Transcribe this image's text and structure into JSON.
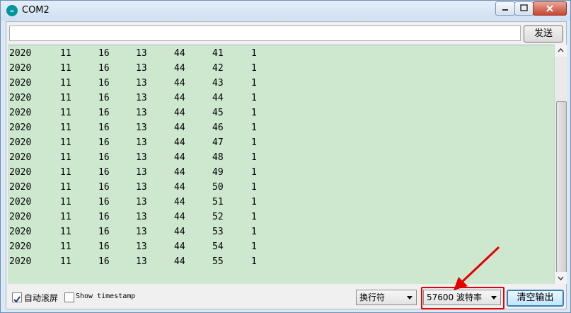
{
  "window": {
    "title": "COM2"
  },
  "send": {
    "input_value": "",
    "button_label": "发送"
  },
  "output": {
    "rows": [
      [
        "2020",
        "11",
        "16",
        "13",
        "44",
        "41",
        "1"
      ],
      [
        "2020",
        "11",
        "16",
        "13",
        "44",
        "42",
        "1"
      ],
      [
        "2020",
        "11",
        "16",
        "13",
        "44",
        "43",
        "1"
      ],
      [
        "2020",
        "11",
        "16",
        "13",
        "44",
        "44",
        "1"
      ],
      [
        "2020",
        "11",
        "16",
        "13",
        "44",
        "45",
        "1"
      ],
      [
        "2020",
        "11",
        "16",
        "13",
        "44",
        "46",
        "1"
      ],
      [
        "2020",
        "11",
        "16",
        "13",
        "44",
        "47",
        "1"
      ],
      [
        "2020",
        "11",
        "16",
        "13",
        "44",
        "48",
        "1"
      ],
      [
        "2020",
        "11",
        "16",
        "13",
        "44",
        "49",
        "1"
      ],
      [
        "2020",
        "11",
        "16",
        "13",
        "44",
        "50",
        "1"
      ],
      [
        "2020",
        "11",
        "16",
        "13",
        "44",
        "51",
        "1"
      ],
      [
        "2020",
        "11",
        "16",
        "13",
        "44",
        "52",
        "1"
      ],
      [
        "2020",
        "11",
        "16",
        "13",
        "44",
        "53",
        "1"
      ],
      [
        "2020",
        "11",
        "16",
        "13",
        "44",
        "54",
        "1"
      ],
      [
        "2020",
        "11",
        "16",
        "13",
        "44",
        "55",
        "1"
      ]
    ]
  },
  "footer": {
    "autoscroll_label": "自动滚屏",
    "autoscroll_checked": true,
    "timestamp_label": "Show timestamp",
    "timestamp_checked": false,
    "line_ending": "换行符",
    "baud_rate": "57600 波特率",
    "clear_label": "清空输出"
  },
  "colors": {
    "output_bg": "#cde8cf",
    "highlight": "#e50000"
  }
}
